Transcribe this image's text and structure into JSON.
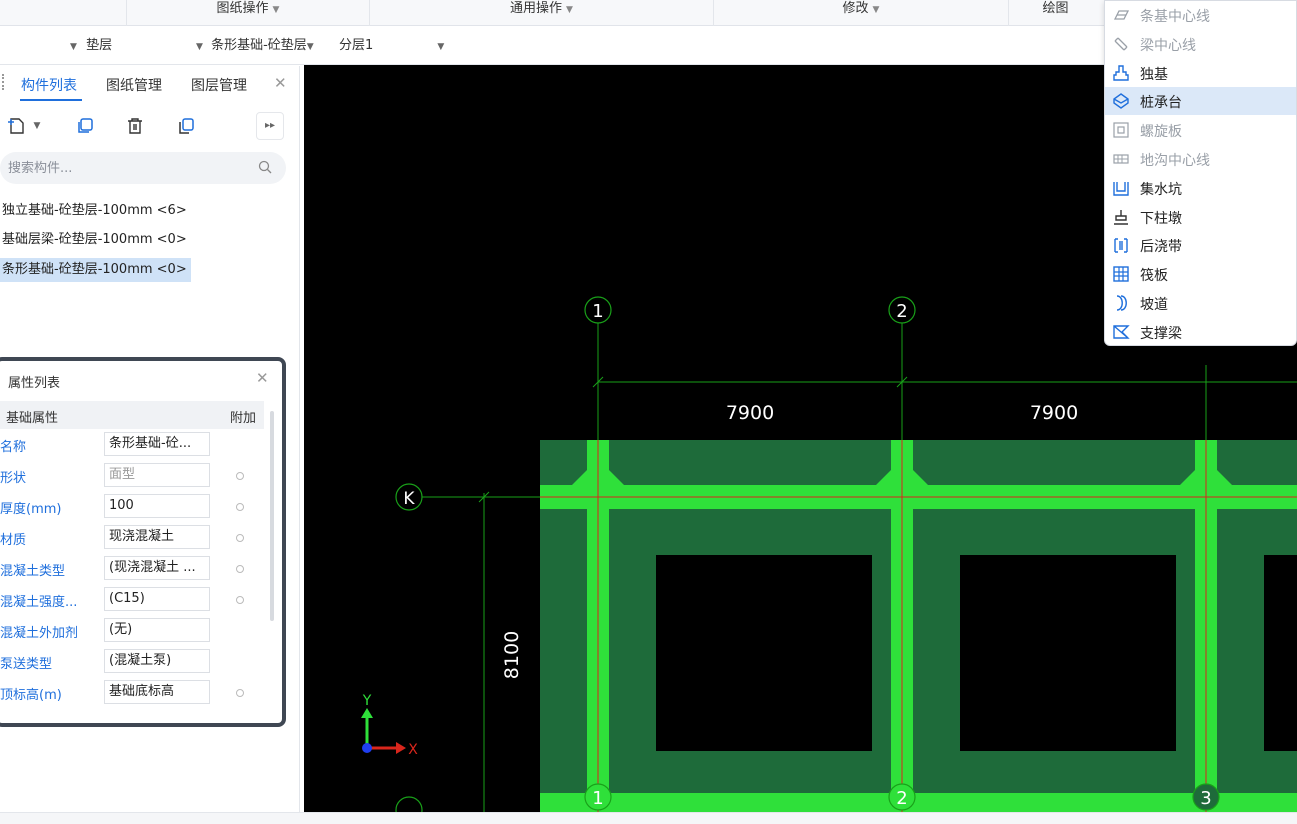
{
  "ribbon": {
    "groups": [
      "图纸操作",
      "通用操作",
      "修改",
      "绘图"
    ]
  },
  "selectors": {
    "layer_type": "垫层",
    "component_type": "条形基础-砼垫层",
    "floor": "分层1"
  },
  "left_tabs": [
    "构件列表",
    "图纸管理",
    "图层管理"
  ],
  "search": {
    "placeholder": "搜索构件..."
  },
  "components": [
    "独立基础-砼垫层-100mm <6>",
    "基础层梁-砼垫层-100mm <0>",
    "条形基础-砼垫层-100mm <0>"
  ],
  "properties": {
    "title": "属性列表",
    "col_name": "基础属性",
    "col_extra": "附加",
    "rows": [
      {
        "name": "名称",
        "value": "条形基础-砼...",
        "dot": false
      },
      {
        "name": "形状",
        "value": "面型",
        "dot": true,
        "disabled": true
      },
      {
        "name": "厚度(mm)",
        "value": "100",
        "dot": true
      },
      {
        "name": "材质",
        "value": "现浇混凝土",
        "dot": true
      },
      {
        "name": "混凝土类型",
        "value": "(现浇混凝土 ...",
        "dot": true
      },
      {
        "name": "混凝土强度...",
        "value": "(C15)",
        "dot": true
      },
      {
        "name": "混凝土外加剂",
        "value": "(无)",
        "dot": false
      },
      {
        "name": "泵送类型",
        "value": "(混凝土泵)",
        "dot": false
      },
      {
        "name": "顶标高(m)",
        "value": "基础底标高",
        "dot": true
      }
    ]
  },
  "canvas": {
    "axis_labels_top": [
      "1",
      "2"
    ],
    "axis_labels_bottom": [
      "1",
      "2",
      "3"
    ],
    "axis_label_left": "K",
    "dimensions": [
      "7900",
      "7900",
      "8100"
    ],
    "coord_x": "X",
    "coord_y": "Y",
    "colors": {
      "slab": "#1e6b3a",
      "beam": "#2fe03a",
      "axis": "#19a019",
      "centerline": "#d9261c"
    }
  },
  "dropdown": {
    "items": [
      {
        "label": "条基中心线",
        "icon": "strip-centerline-icon",
        "disabled": true
      },
      {
        "label": "梁中心线",
        "icon": "beam-centerline-icon",
        "disabled": true
      },
      {
        "label": "独基",
        "icon": "isolated-footing-icon",
        "disabled": false
      },
      {
        "label": "桩承台",
        "icon": "pile-cap-icon",
        "disabled": false,
        "highlighted": true
      },
      {
        "label": "螺旋板",
        "icon": "spiral-plate-icon",
        "disabled": true
      },
      {
        "label": "地沟中心线",
        "icon": "trench-centerline-icon",
        "disabled": true
      },
      {
        "label": "集水坑",
        "icon": "sump-icon",
        "disabled": false
      },
      {
        "label": "下柱墩",
        "icon": "column-pier-icon",
        "disabled": false
      },
      {
        "label": "后浇带",
        "icon": "post-cast-strip-icon",
        "disabled": false
      },
      {
        "label": "筏板",
        "icon": "raft-slab-icon",
        "disabled": false
      },
      {
        "label": "坡道",
        "icon": "ramp-icon",
        "disabled": false
      },
      {
        "label": "支撑梁",
        "icon": "support-beam-icon",
        "disabled": false
      }
    ]
  }
}
